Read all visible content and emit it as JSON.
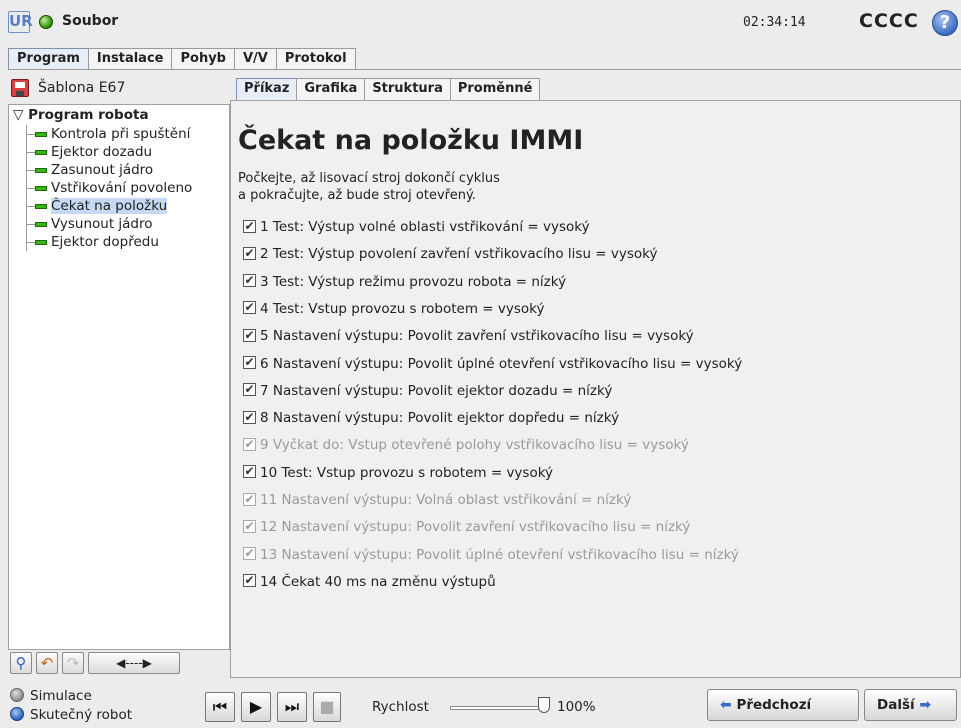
{
  "titlebar": {
    "logo_text": "UR",
    "file_label": "Soubor",
    "clock": "02:34:14",
    "robot_name": "CCCC",
    "help": "?"
  },
  "main_tabs": [
    {
      "label": "Program",
      "active": true
    },
    {
      "label": "Instalace",
      "active": false
    },
    {
      "label": "Pohyb",
      "active": false
    },
    {
      "label": "V/V",
      "active": false
    },
    {
      "label": "Protokol",
      "active": false
    }
  ],
  "left": {
    "template_name": "Šablona E67",
    "tree": {
      "root": "Program robota",
      "items": [
        {
          "label": "Kontrola při spuštění",
          "selected": false
        },
        {
          "label": "Ejektor dozadu",
          "selected": false
        },
        {
          "label": "Zasunout jádro",
          "selected": false
        },
        {
          "label": "Vstřikování povoleno",
          "selected": false
        },
        {
          "label": "Čekat na položku",
          "selected": true
        },
        {
          "label": "Vysunout jádro",
          "selected": false
        },
        {
          "label": "Ejektor dopředu",
          "selected": false
        }
      ]
    }
  },
  "sub_tabs": [
    {
      "label": "Příkaz",
      "active": true
    },
    {
      "label": "Grafika",
      "active": false
    },
    {
      "label": "Struktura",
      "active": false
    },
    {
      "label": "Proměnné",
      "active": false
    }
  ],
  "command": {
    "title": "Čekat na položku IMMI",
    "desc_line1": "Počkejte, až lisovací stroj dokončí cyklus",
    "desc_line2": "a pokračujte, až bude stroj otevřený.",
    "lines": [
      {
        "text": "1 Test: Výstup volné oblasti vstřikování = vysoký",
        "checked": true,
        "enabled": true
      },
      {
        "text": "2 Test: Výstup povolení zavření vstřikovacího lisu = vysoký",
        "checked": true,
        "enabled": true
      },
      {
        "text": "3 Test: Výstup režimu provozu robota = nízký",
        "checked": true,
        "enabled": true
      },
      {
        "text": "4 Test: Vstup provozu s robotem = vysoký",
        "checked": true,
        "enabled": true
      },
      {
        "text": "5 Nastavení výstupu: Povolit zavření vstřikovacího lisu = vysoký",
        "checked": true,
        "enabled": true
      },
      {
        "text": "6 Nastavení výstupu: Povolit úplné otevření vstřikovacího lisu = vysoký",
        "checked": true,
        "enabled": true
      },
      {
        "text": "7 Nastavení výstupu: Povolit ejektor dozadu = nízký",
        "checked": true,
        "enabled": true
      },
      {
        "text": "8 Nastavení výstupu: Povolit ejektor dopředu = nízký",
        "checked": true,
        "enabled": true
      },
      {
        "text": "9 Vyčkat do: Vstup otevřené polohy vstřikovacího lisu = vysoký",
        "checked": true,
        "enabled": false
      },
      {
        "text": "10 Test: Vstup provozu s robotem = vysoký",
        "checked": true,
        "enabled": true
      },
      {
        "text": "11 Nastavení výstupu: Volná oblast vstřikování = nízký",
        "checked": true,
        "enabled": false
      },
      {
        "text": "12 Nastavení výstupu: Povolit zavření vstřikovacího lisu = nízký",
        "checked": true,
        "enabled": false
      },
      {
        "text": "13 Nastavení výstupu: Povolit úplné otevření vstřikovacího lisu = nízký",
        "checked": true,
        "enabled": false
      },
      {
        "text": "14 Čekat 40 ms na změnu výstupů",
        "checked": true,
        "enabled": true
      }
    ]
  },
  "bottom": {
    "mode_simulation": "Simulace",
    "mode_real": "Skutečný robot",
    "speed_label": "Rychlost",
    "speed_value": "100%",
    "speed_fraction": 1.0,
    "prev_label": "Předchozí",
    "next_label": "Další"
  }
}
